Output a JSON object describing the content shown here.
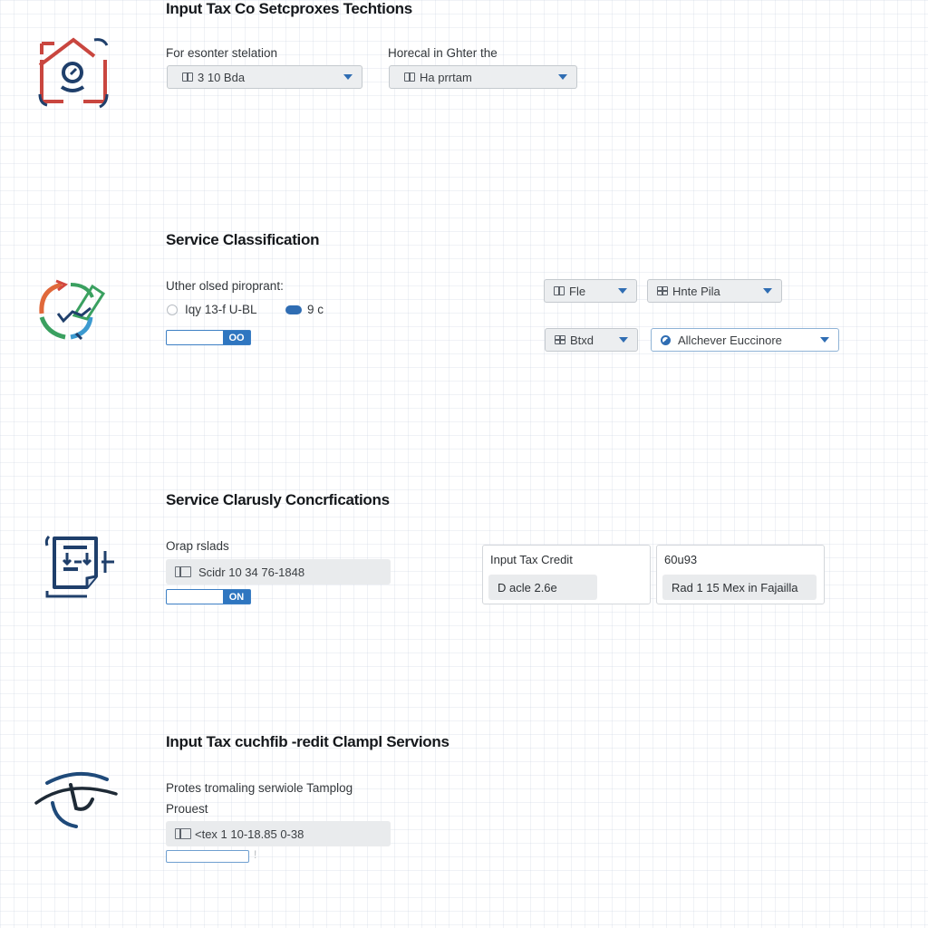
{
  "section1": {
    "title": "Input Tax Co Setcproxes Techtions",
    "icon": "house-clock-icon",
    "field_a": {
      "label": "For esonter stelation",
      "value": "3 10 Bda"
    },
    "field_b": {
      "label": "Horecal in Ghter the",
      "value": "Ha prrtam"
    }
  },
  "section2": {
    "title": "Service Classification",
    "icon": "refresh-checklist-icon",
    "label": "Uther olsed piroprant:",
    "radio_option": "Iqy 13-f U-BL",
    "pill_option": "9 c",
    "toggle_label": "OO",
    "dropdowns": [
      {
        "value": "Fle"
      },
      {
        "value": "Hnte Pila"
      },
      {
        "value": "Btxd"
      },
      {
        "value": "Allchever Euccinore"
      }
    ]
  },
  "section3": {
    "title": "Service Clarusly Concrfications",
    "icon": "document-sort-icon",
    "label": "Orap rslads",
    "field_value": "Scidr 10 34 76-1848",
    "toggle_label": "ON",
    "cards": [
      {
        "title": "Input Tax Credit",
        "value": "D acle 2.6e"
      },
      {
        "title": "60u93",
        "value": "Rad 1 15 Mex in Fajailla"
      }
    ]
  },
  "section4": {
    "title": "Input Tax cuchfib -redit Clampl Servions",
    "icon": "eye-icon",
    "label_1": "Protes tromaling serwiole Tamplog",
    "label_2": "Prouest",
    "field_value": "<tex 1 10-18.85 0-38",
    "toggle_suffix": "!"
  },
  "colors": {
    "accent": "#2f6db3",
    "icon_red": "#c9463f",
    "icon_navy": "#1f3f6b",
    "field_bg": "#e9ebed"
  }
}
